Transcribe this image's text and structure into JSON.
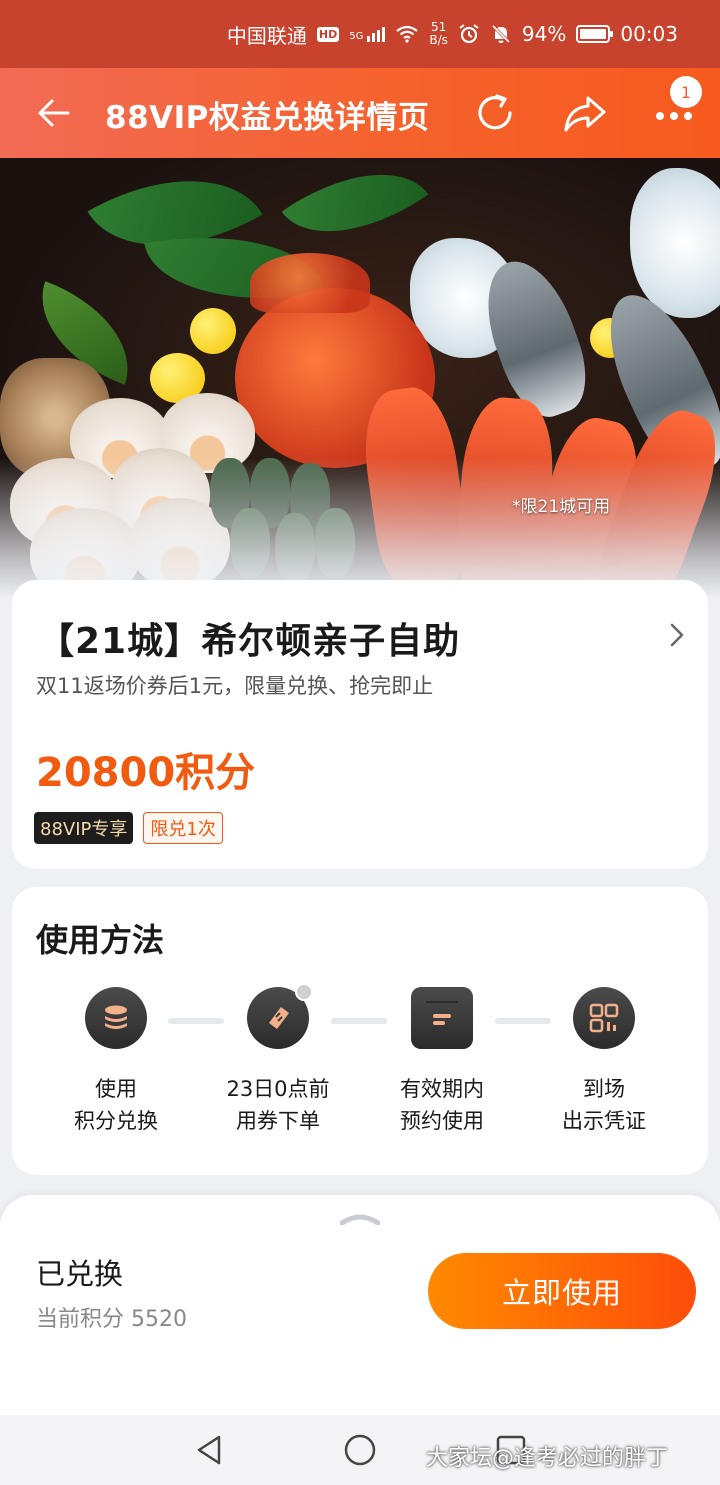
{
  "status_bar": {
    "carrier": "中国联通",
    "hd_badge": "HD",
    "network": "5G",
    "speed_value": "51",
    "speed_unit": "B/s",
    "battery": "94%",
    "time": "00:03"
  },
  "header": {
    "title": "88VIP权益兑换详情页",
    "notification_count": "1",
    "icons": [
      "arrow-left-icon",
      "refresh-icon",
      "share-icon",
      "more-icon"
    ]
  },
  "hero": {
    "note": "*限21城可用"
  },
  "product": {
    "name": "【21城】希尔顿亲子自助",
    "subtitle": "双11返场价券后1元，限量兑换、抢完即止",
    "price": "20800积分",
    "tag_vip": "88VIP专享",
    "tag_limit": "限兑1次"
  },
  "usage": {
    "heading": "使用方法",
    "steps": [
      {
        "line1": "使用",
        "line2": "积分兑换",
        "icon": "coins-icon"
      },
      {
        "line1": "23日0点前",
        "line2": "用券下单",
        "icon": "ticket-icon"
      },
      {
        "line1": "有效期内",
        "line2": "预约使用",
        "icon": "calendar-icon"
      },
      {
        "line1": "到场",
        "line2": "出示凭证",
        "icon": "qrcode-icon"
      }
    ]
  },
  "bottom_sheet": {
    "state": "已兑换",
    "points_label": "当前积分 5520",
    "cta_label": "立即使用"
  },
  "watermark": "大家坛@逢考必过的胖丁",
  "colors": {
    "accent": "#f25a10",
    "header_start": "#f26b55",
    "header_end": "#f65a1e",
    "status_bar": "#c8432e"
  }
}
